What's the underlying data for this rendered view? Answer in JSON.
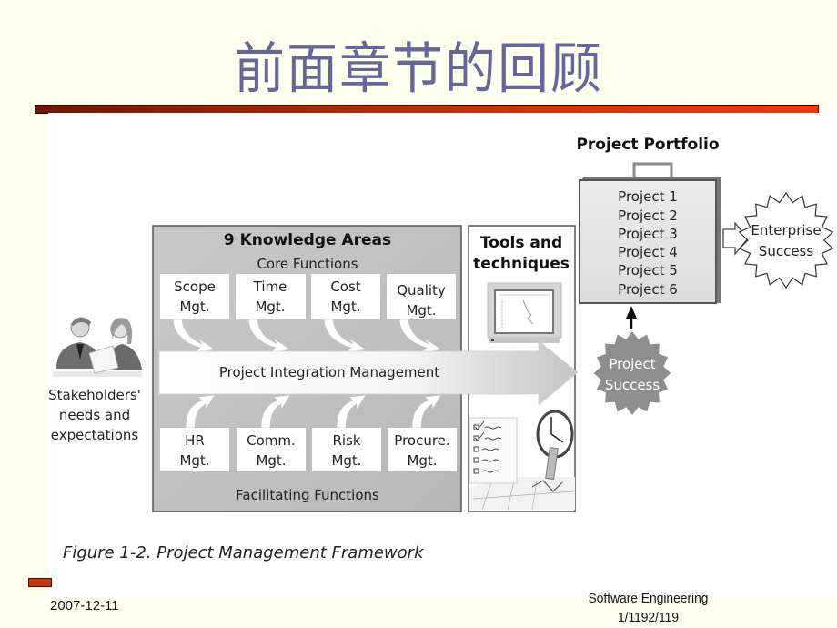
{
  "slide": {
    "title": "前面章节的回顾",
    "footer": {
      "date": "2007-12-11",
      "course": "Software Engineering",
      "page": "1/1192/119"
    }
  },
  "figure": {
    "caption": "Figure 1-2. Project Management Framework",
    "stakeholders": {
      "icon": "people-meeting-icon",
      "label_lines": [
        "Stakeholders'",
        "needs and",
        "expectations"
      ]
    },
    "knowledge_areas": {
      "title": "9 Knowledge Areas",
      "core_label": "Core Functions",
      "core": [
        {
          "lines": [
            "Scope",
            "Mgt."
          ]
        },
        {
          "lines": [
            "Time",
            "Mgt."
          ]
        },
        {
          "lines": [
            "Cost",
            "Mgt."
          ]
        },
        {
          "lines": [
            "Quality",
            "Mgt."
          ]
        }
      ],
      "integration": "Project Integration Management",
      "facilitating": [
        {
          "lines": [
            "HR",
            "Mgt."
          ]
        },
        {
          "lines": [
            "Comm.",
            "Mgt."
          ]
        },
        {
          "lines": [
            "Risk",
            "Mgt."
          ]
        },
        {
          "lines": [
            "Procure.",
            "Mgt."
          ]
        }
      ],
      "facilitating_label": "Facilitating Functions"
    },
    "tools": {
      "title_lines": [
        "Tools and",
        "techniques"
      ],
      "icons": [
        "computer-monitor-icon",
        "checklist-icon",
        "clock-icon"
      ]
    },
    "project_success": {
      "lines": [
        "Project",
        "Success"
      ]
    },
    "portfolio": {
      "title": "Project Portfolio",
      "projects": [
        "Project 1",
        "Project 2",
        "Project 3",
        "Project 4",
        "Project 5",
        "Project 6"
      ]
    },
    "enterprise_success": {
      "lines": [
        "Enterprise",
        "Success"
      ]
    }
  }
}
